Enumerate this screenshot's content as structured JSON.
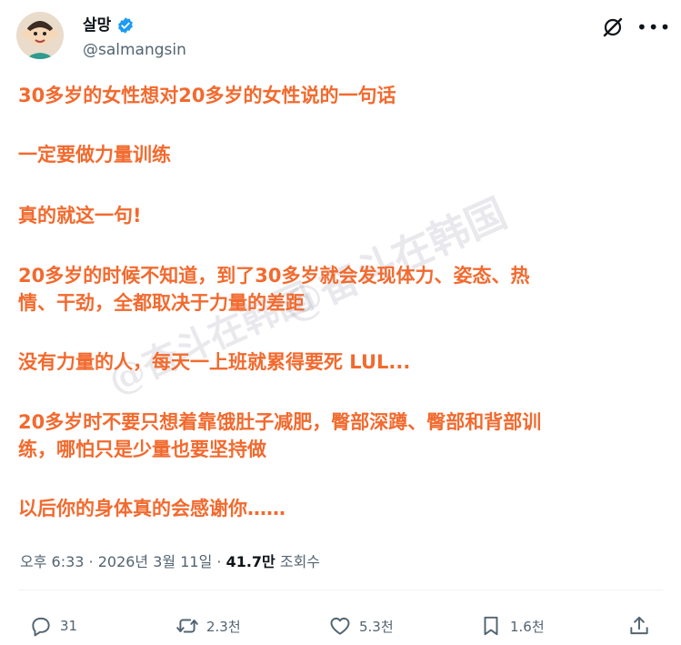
{
  "author": {
    "display_name": "살망",
    "handle": "@salmangsin",
    "verified": true
  },
  "post": {
    "paragraphs": [
      [
        "30多岁的女性想对20多岁的女性说的一句话"
      ],
      [
        "一定要做力量训练"
      ],
      [
        "真的就这一句!"
      ],
      [
        "20多岁的时候不知道，到了30多岁就会发现体力、姿态、热",
        "情、干劲，全都取决于力量的差距"
      ],
      [
        "没有力量的人，每天一上班就累得要死 LUL..."
      ],
      [
        "20多岁时不要只想着靠饿肚子减肥，臀部深蹲、臀部和背部训",
        "练，哪怕只是少量也要坚持做"
      ],
      [
        "以后你的身体真的会感谢你……"
      ]
    ],
    "watermark": "@奋斗在韩国"
  },
  "meta": {
    "time": "오후 6:33 · 2026년 3월 11일 · ",
    "views": "41.7만",
    "views_label": " 조회수"
  },
  "actions": {
    "reply": "31",
    "retweet": "2.3천",
    "like": "5.3천",
    "bookmark": "1.6천"
  },
  "colors": {
    "accent_text": "#f26a2e",
    "verified": "#1d9bf0",
    "muted": "#536471"
  }
}
